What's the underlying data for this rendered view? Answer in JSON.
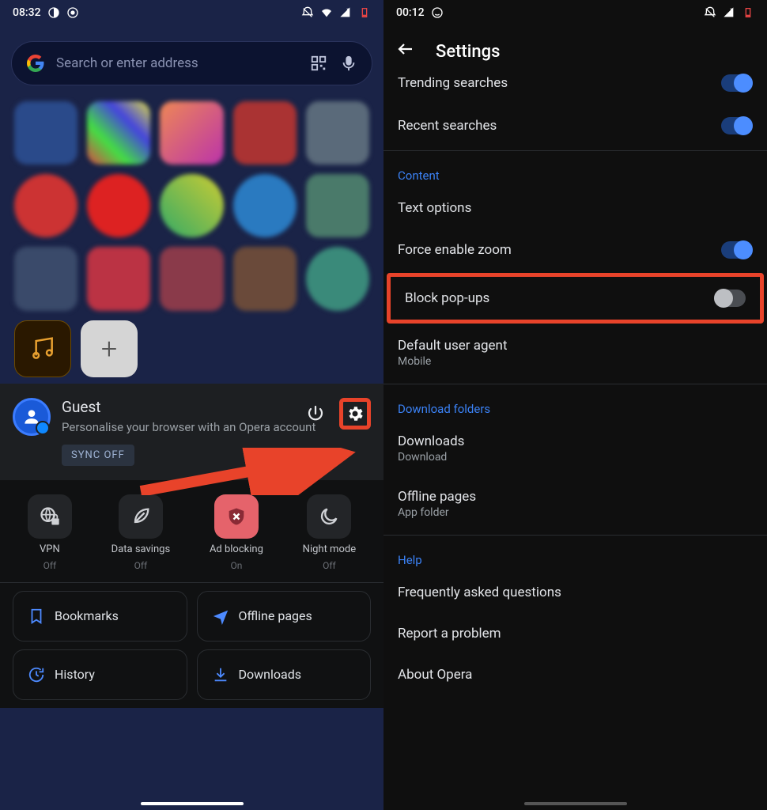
{
  "left": {
    "status": {
      "time": "08:32",
      "icons": [
        "firefox",
        "chrome"
      ]
    },
    "search": {
      "placeholder": "Search or enter address"
    },
    "bottom_tiles": {
      "music": "music",
      "plus": "+"
    },
    "account": {
      "name": "Guest",
      "subtitle": "Personalise your browser with an Opera account",
      "sync_badge": "SYNC OFF"
    },
    "quick": [
      {
        "label": "VPN",
        "sub": "Off"
      },
      {
        "label": "Data savings",
        "sub": "Off"
      },
      {
        "label": "Ad blocking",
        "sub": "On"
      },
      {
        "label": "Night mode",
        "sub": "Off"
      }
    ],
    "tiles": [
      {
        "label": "Bookmarks"
      },
      {
        "label": "Offline pages"
      },
      {
        "label": "History"
      },
      {
        "label": "Downloads"
      }
    ]
  },
  "right": {
    "status": {
      "time": "00:12"
    },
    "title": "Settings",
    "rows_top": [
      {
        "label": "Trending searches",
        "toggle": "on",
        "cut": true
      },
      {
        "label": "Recent searches",
        "toggle": "on"
      }
    ],
    "section_content": "Content",
    "rows_content": [
      {
        "label": "Text options"
      },
      {
        "label": "Force enable zoom",
        "toggle": "on"
      },
      {
        "label": "Block pop-ups",
        "toggle": "off",
        "highlight": true
      },
      {
        "label": "Default user agent",
        "sub": "Mobile"
      }
    ],
    "section_download": "Download folders",
    "rows_download": [
      {
        "label": "Downloads",
        "sub": "Download"
      },
      {
        "label": "Offline pages",
        "sub": "App folder"
      }
    ],
    "section_help": "Help",
    "rows_help": [
      {
        "label": "Frequently asked questions"
      },
      {
        "label": "Report a problem"
      },
      {
        "label": "About Opera"
      }
    ]
  }
}
